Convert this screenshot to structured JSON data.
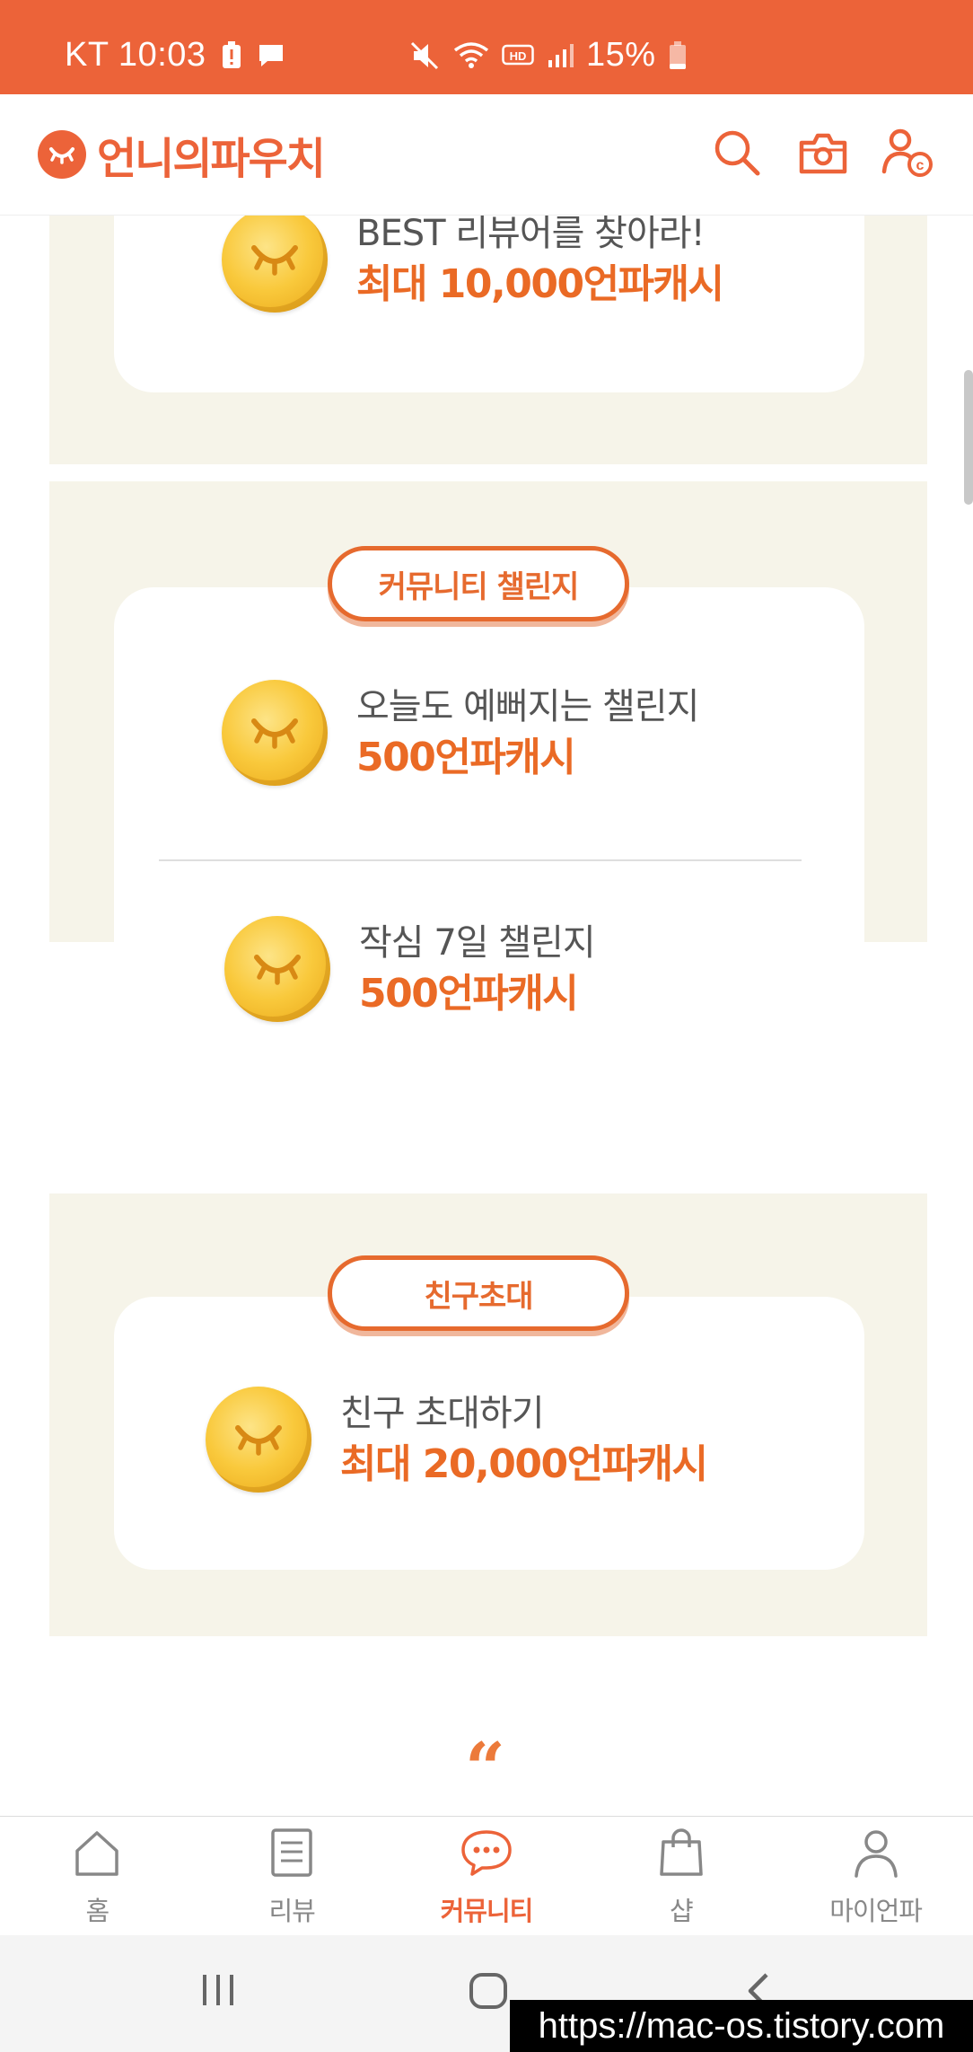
{
  "status_bar": {
    "carrier_time": "KT 10:03",
    "battery_percent": "15%",
    "icons": [
      "battery-alert-icon",
      "chat-bubble-icon",
      "mute-icon",
      "wifi-icon",
      "hd-icon",
      "signal-icon",
      "battery-icon"
    ]
  },
  "header": {
    "app_name": "언니의파우치",
    "icons": [
      "search-icon",
      "camera-icon",
      "profile-cash-icon"
    ]
  },
  "sections": {
    "best_review": {
      "title": "BEST 리뷰어를 찾아라!",
      "amount": "최대 10,000언파캐시"
    },
    "community_challenge": {
      "pill": "커뮤니티 챌린지",
      "items": [
        {
          "title": "오늘도 예뻐지는 챌린지",
          "amount": "500언파캐시"
        },
        {
          "title": "작심 7일 챌린지",
          "amount": "500언파캐시"
        }
      ]
    },
    "friend_invite": {
      "pill": "친구초대",
      "title": "친구 초대하기",
      "amount": "최대 20,000언파캐시"
    }
  },
  "quote_mark": "“",
  "bottom_nav": {
    "items": [
      {
        "label": "홈",
        "icon": "home-icon"
      },
      {
        "label": "리뷰",
        "icon": "document-icon"
      },
      {
        "label": "커뮤니티",
        "icon": "chat-icon",
        "active": true
      },
      {
        "label": "샵",
        "icon": "shopping-bag-icon"
      },
      {
        "label": "마이언파",
        "icon": "person-icon"
      }
    ]
  },
  "system_nav": {
    "icons": [
      "recent-apps-icon",
      "home-button-icon",
      "back-icon"
    ]
  },
  "watermark": "https://mac-os.tistory.com",
  "colors": {
    "accent": "#ec6339",
    "section_bg": "#f6f4e9",
    "reward_amount": "#ea6a25",
    "inactive_nav": "#888888"
  }
}
